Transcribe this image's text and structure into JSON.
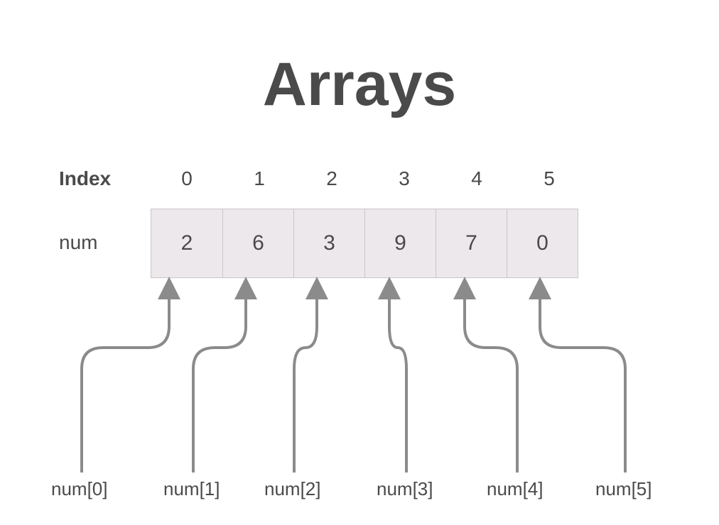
{
  "title": "Arrays",
  "index_label": "Index",
  "array_name_label": "num",
  "cells": [
    {
      "index": "0",
      "value": "2",
      "access_label": "num[0]"
    },
    {
      "index": "1",
      "value": "6",
      "access_label": "num[1]"
    },
    {
      "index": "2",
      "value": "3",
      "access_label": "num[2]"
    },
    {
      "index": "3",
      "value": "9",
      "access_label": "num[3]"
    },
    {
      "index": "4",
      "value": "7",
      "access_label": "num[4]"
    },
    {
      "index": "5",
      "value": "0",
      "access_label": "num[5]"
    }
  ],
  "colors": {
    "text": "#4a4a4a",
    "cell_bg": "#ece8eb",
    "cell_border": "#c9c5c8",
    "arrow": "#8b8b8b"
  }
}
